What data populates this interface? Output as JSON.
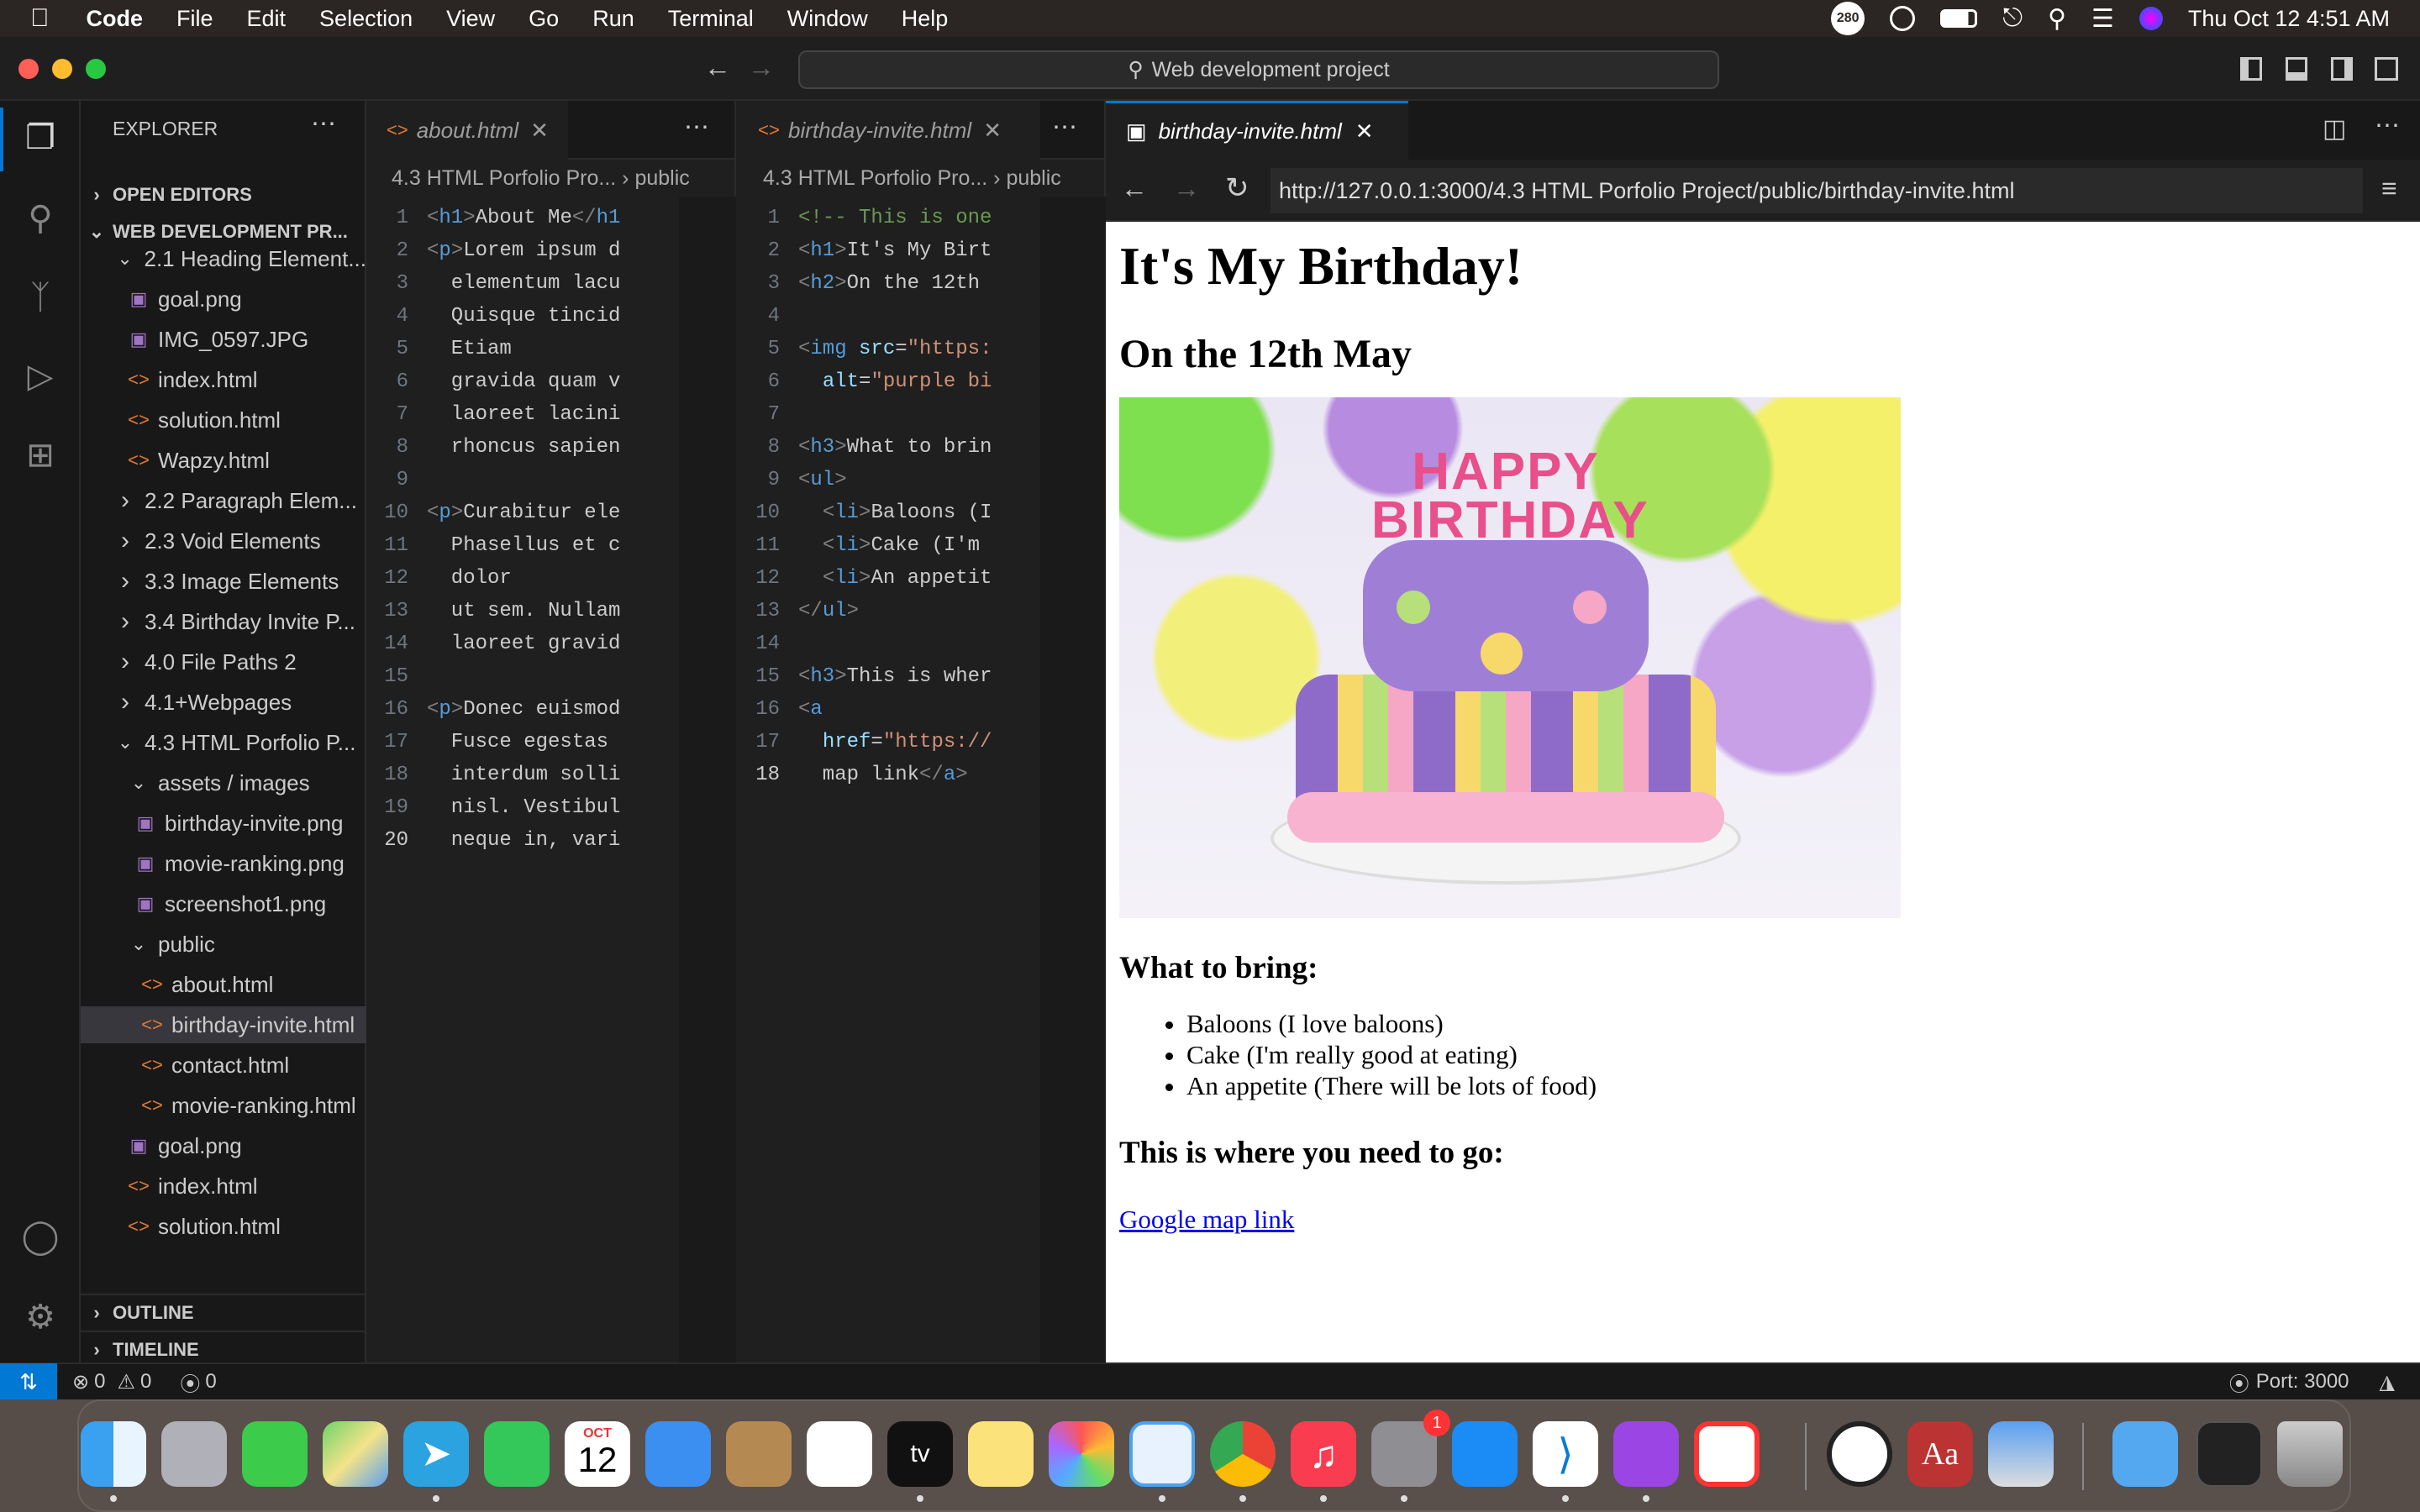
{
  "menubar": {
    "app": "Code",
    "items": [
      "File",
      "Edit",
      "Selection",
      "View",
      "Go",
      "Run",
      "Terminal",
      "Window",
      "Help"
    ],
    "badge": "280",
    "datetime": "Thu Oct 12  4:51 AM"
  },
  "window": {
    "command_center": "Web development project"
  },
  "explorer": {
    "title": "EXPLORER",
    "open_editors": "OPEN EDITORS",
    "workspace": "WEB DEVELOPMENT PR...",
    "items": [
      {
        "label": "2.1 Heading Element...",
        "type": "folder-open"
      },
      {
        "label": "goal.png",
        "type": "img"
      },
      {
        "label": "IMG_0597.JPG",
        "type": "img"
      },
      {
        "label": "index.html",
        "type": "html"
      },
      {
        "label": "solution.html",
        "type": "html"
      },
      {
        "label": "Wapzy.html",
        "type": "html"
      },
      {
        "label": "2.2 Paragraph Elem...",
        "type": "folder"
      },
      {
        "label": "2.3 Void Elements",
        "type": "folder"
      },
      {
        "label": "3.3 Image Elements",
        "type": "folder"
      },
      {
        "label": "3.4 Birthday Invite P...",
        "type": "folder"
      },
      {
        "label": "4.0 File Paths 2",
        "type": "folder"
      },
      {
        "label": "4.1+Webpages",
        "type": "folder"
      },
      {
        "label": "4.3 HTML Porfolio P...",
        "type": "folder-open"
      },
      {
        "label": "assets / images",
        "type": "folder-open"
      },
      {
        "label": "birthday-invite.png",
        "type": "img"
      },
      {
        "label": "movie-ranking.png",
        "type": "img"
      },
      {
        "label": "screenshot1.png",
        "type": "img"
      },
      {
        "label": "public",
        "type": "folder-open"
      },
      {
        "label": "about.html",
        "type": "html"
      },
      {
        "label": "birthday-invite.html",
        "type": "html"
      },
      {
        "label": "contact.html",
        "type": "html"
      },
      {
        "label": "movie-ranking.html",
        "type": "html"
      },
      {
        "label": "goal.png",
        "type": "img"
      },
      {
        "label": "index.html",
        "type": "html"
      },
      {
        "label": "solution.html",
        "type": "html"
      }
    ],
    "outline": "OUTLINE",
    "timeline": "TIMELINE"
  },
  "editor1": {
    "tab": "about.html",
    "breadcrumb": "4.3 HTML Porfolio Pro...  ›  public",
    "lines": [
      "<h1>About Me</h1",
      "<p>Lorem ipsum d",
      "  elementum lacu",
      "  Quisque tincid",
      "  Etiam",
      "  gravida quam v",
      "  laoreet lacini",
      "  rhoncus sapien",
      "",
      "<p>Curabitur ele",
      "  Phasellus et c",
      "  dolor",
      "  ut sem. Nullam",
      "  laoreet gravid",
      "",
      "<p>Donec euismod",
      "  Fusce egestas ",
      "  interdum solli",
      "  nisl. Vestibul",
      "  neque in, vari"
    ],
    "current_line": 20
  },
  "editor2": {
    "tab": "birthday-invite.html",
    "breadcrumb": "4.3 HTML Porfolio Pro...  ›  public",
    "lines": [
      "<!-- This is one",
      "<h1>It's My Birt",
      "<h2>On the 12th ",
      "",
      "<img src=\"https:",
      "  alt=\"purple bi",
      "",
      "<h3>What to brin",
      "<ul>",
      "  <li>Baloons (I",
      "  <li>Cake (I'm ",
      "  <li>An appetit",
      "</ul>",
      "",
      "<h3>This is wher",
      "<a",
      "  href=\"https://",
      "  map link</a>"
    ],
    "current_line": 18
  },
  "browser": {
    "tab": "birthday-invite.html",
    "url": "http://127.0.0.1:3000/4.3 HTML Porfolio Project/public/birthday-invite.html",
    "page": {
      "h1": "It's My Birthday!",
      "h2": "On the 12th May",
      "cake_text": "HAPPY BIRTHDAY",
      "h3_bring": "What to bring:",
      "list": [
        "Baloons (I love baloons)",
        "Cake (I'm really good at eating)",
        "An appetite (There will be lots of food)"
      ],
      "h3_go": "This is where you need to go:",
      "link": "Google map link"
    }
  },
  "statusbar": {
    "errors": "0",
    "warnings": "0",
    "ports_count": "0",
    "port": "Port: 3000"
  },
  "dock": {
    "calendar_month": "OCT",
    "calendar_day": "12",
    "settings_badge": "1"
  },
  "colors": {
    "accent": "#0078d4",
    "html_icon": "#e37933",
    "image_icon": "#a074c4"
  }
}
